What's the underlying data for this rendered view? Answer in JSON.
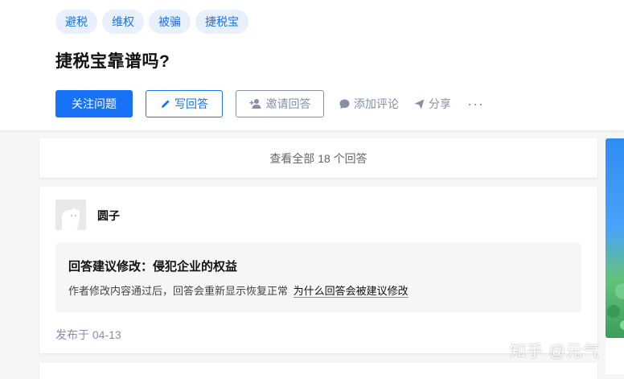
{
  "topics": [
    "避税",
    "维权",
    "被骗",
    "捷税宝"
  ],
  "question_title": "捷税宝靠谱吗?",
  "actions": {
    "follow": "关注问题",
    "write": "写回答",
    "invite": "邀请回答",
    "comment": "添加评论",
    "share": "分享",
    "more": "···"
  },
  "view_all": "查看全部 18 个回答",
  "answer": {
    "author": "圆子",
    "notice_title": "回答建议修改：侵犯企业的权益",
    "notice_body": "作者修改内容通过后，回答会重新显示恢复正常",
    "notice_link": "为什么回答会被建议修改",
    "published": "发布于 04-13"
  },
  "watermark": "知乎 @元气",
  "colors": {
    "brand": "#1772f6",
    "muted": "#8590a6",
    "background": "#f6f6f6"
  }
}
